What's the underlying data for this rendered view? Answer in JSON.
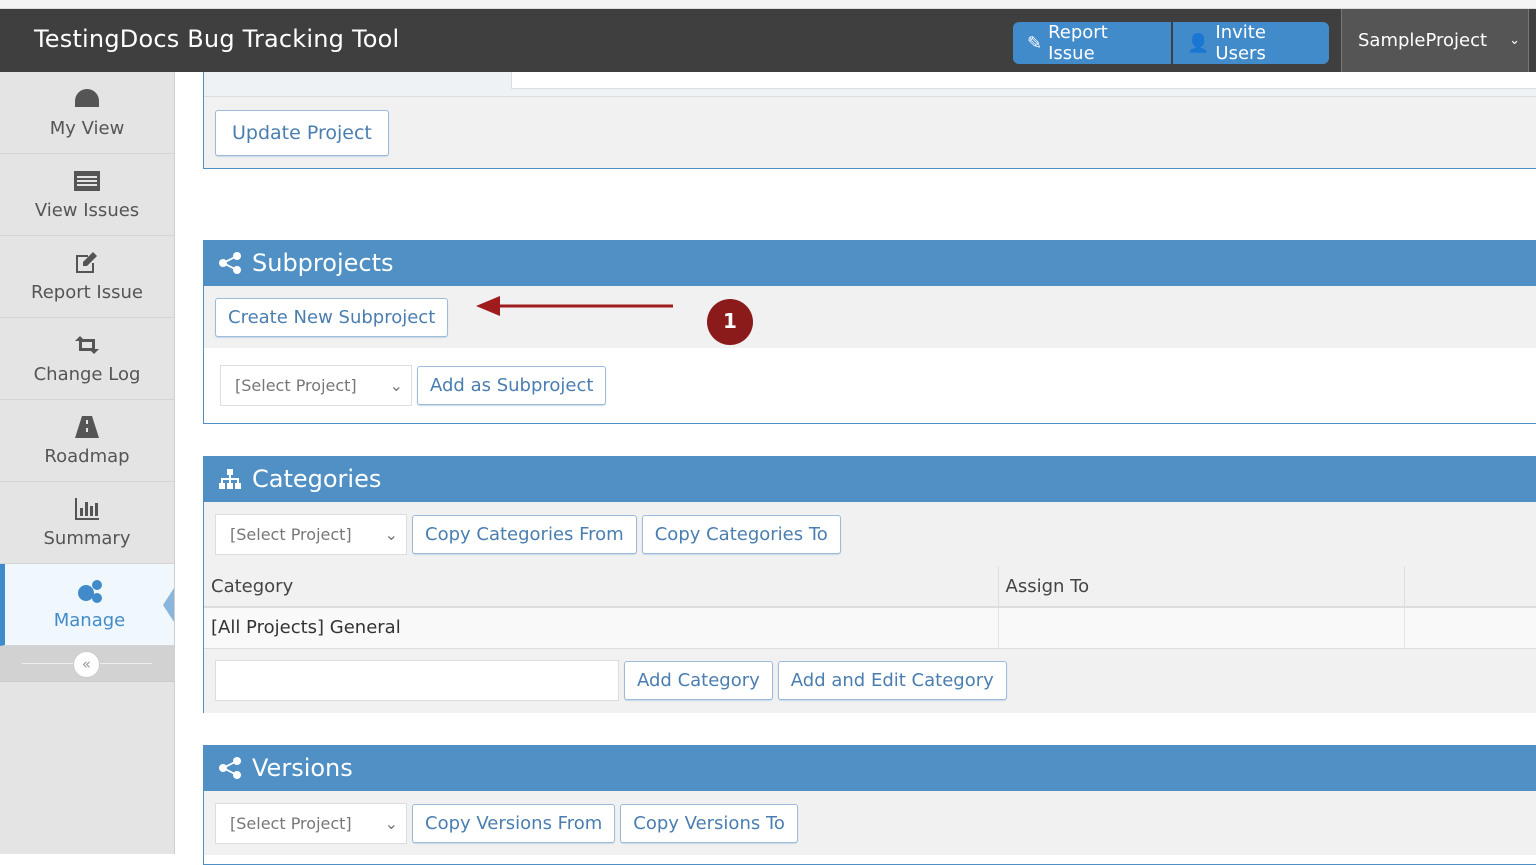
{
  "header": {
    "title": "TestingDocs Bug Tracking Tool",
    "report_issue": "Report Issue",
    "invite_users": "Invite Users",
    "project": "SampleProject"
  },
  "sidebar": {
    "items": [
      {
        "label": "My View",
        "icon": "dashboard-icon"
      },
      {
        "label": "View Issues",
        "icon": "list-icon"
      },
      {
        "label": "Report Issue",
        "icon": "edit-icon"
      },
      {
        "label": "Change Log",
        "icon": "retweet-icon"
      },
      {
        "label": "Roadmap",
        "icon": "road-icon"
      },
      {
        "label": "Summary",
        "icon": "bar-chart-icon"
      },
      {
        "label": "Manage",
        "icon": "gears-icon",
        "active": true
      }
    ],
    "collapse": "«"
  },
  "project_box": {
    "update_button": "Update Project"
  },
  "subprojects": {
    "title": "Subprojects",
    "create_button": "Create New Subproject",
    "select": "[Select Project]",
    "add_button": "Add as Subproject"
  },
  "annotation": {
    "number": "1",
    "color": "#8b1a1a"
  },
  "categories": {
    "title": "Categories",
    "select": "[Select Project]",
    "copy_from": "Copy Categories From",
    "copy_to": "Copy Categories To",
    "columns": [
      "Category",
      "Assign To",
      ""
    ],
    "rows": [
      [
        "[All Projects] General",
        "",
        ""
      ]
    ],
    "input_value": "",
    "add_button": "Add Category",
    "add_edit_button": "Add and Edit Category"
  },
  "versions": {
    "title": "Versions",
    "select": "[Select Project]",
    "copy_from": "Copy Versions From",
    "copy_to": "Copy Versions To"
  },
  "colors": {
    "header": "#3f3f3f",
    "accent": "#428bca",
    "section": "#5090c4"
  }
}
